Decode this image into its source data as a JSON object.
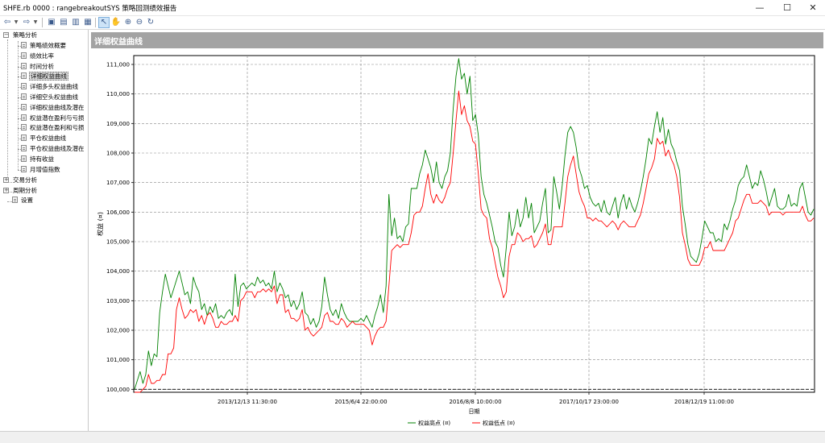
{
  "window": {
    "title": "SHFE.rb 0000 : rangebreakoutSYS 策略回测绩效报告",
    "min_glyph": "—",
    "max_glyph": "☐",
    "close_glyph": "✕"
  },
  "toolbar": {
    "icons": [
      "back-arrow-icon",
      "forward-arrow-icon",
      "save-icon",
      "print-preview-icon",
      "print-icon",
      "report-icon",
      "select-arrow-icon",
      "pan-hand-icon",
      "zoom-in-icon",
      "zoom-out-icon",
      "refresh-icon"
    ]
  },
  "tree": {
    "root_strategy": "策略分析",
    "items": [
      "策略绩效概要",
      "绩效比率",
      "时间分析",
      "详细权益曲线",
      "详细多头权益曲线",
      "详细空头权益曲线",
      "详细权益曲线及潜在",
      "权益潜在盈利与亏损",
      "权益潜在盈利和亏损",
      "平仓权益曲线",
      "平仓权益曲线及潜在",
      "持有收益",
      "月增值指数"
    ],
    "selected_index": 3,
    "root_trade": "交易分析",
    "root_period": "周期分析",
    "root_settings": "设置"
  },
  "content": {
    "header_title": "详细权益曲线"
  },
  "chart_data": {
    "type": "line",
    "ylabel": "权益 (¤)",
    "xlabel": "日期",
    "y_ticks": [
      "100,000",
      "101,000",
      "102,000",
      "103,000",
      "104,000",
      "105,000",
      "106,000",
      "107,000",
      "108,000",
      "109,000",
      "110,000",
      "111,000"
    ],
    "ylim": [
      99900,
      111300
    ],
    "x_ticks": [
      "2013/12/13 11:30:00",
      "2015/6/4 22:00:00",
      "2016/8/8 10:00:00",
      "2017/10/17 23:00:00",
      "2018/12/19 11:00:00"
    ],
    "baseline": 100000,
    "grid": true,
    "legend_position": "bottom",
    "series": [
      {
        "name": "权益高点 (¤)",
        "color": "#008000",
        "values": [
          100000,
          100300,
          100600,
          100200,
          100500,
          101300,
          100800,
          101200,
          101100,
          102600,
          103300,
          103900,
          103500,
          103100,
          103400,
          103700,
          104000,
          103600,
          103200,
          103300,
          102900,
          103800,
          103500,
          103300,
          102700,
          102900,
          102500,
          102800,
          102600,
          102900,
          102400,
          102500,
          102400,
          102600,
          102700,
          102500,
          103900,
          102800,
          103500,
          103600,
          103400,
          103500,
          103600,
          103500,
          103800,
          103600,
          103700,
          103500,
          103600,
          103400,
          104000,
          103300,
          103600,
          103400,
          103100,
          103200,
          102800,
          103000,
          102700,
          102900,
          103300,
          102600,
          102500,
          102200,
          102400,
          102100,
          102300,
          102800,
          103800,
          103200,
          102700,
          102500,
          102700,
          102400,
          102900,
          102600,
          102400,
          102300,
          102300,
          102300,
          102300,
          102400,
          102300,
          102500,
          102300,
          102100,
          102500,
          102800,
          103200,
          102600,
          103500,
          106600,
          105200,
          105800,
          105100,
          105200,
          105000,
          105500,
          105600,
          106800,
          106800,
          106800,
          107300,
          107600,
          108100,
          107800,
          107500,
          107000,
          107700,
          107000,
          106800,
          107200,
          107400,
          108000,
          109500,
          110600,
          111200,
          110500,
          110700,
          110000,
          110600,
          109100,
          109300,
          108600,
          107200,
          106600,
          106300,
          105900,
          105500,
          105000,
          104800,
          104200,
          103800,
          104800,
          106000,
          105200,
          105500,
          106100,
          105500,
          105800,
          106500,
          105800,
          106300,
          105300,
          105500,
          105700,
          106300,
          106800,
          105300,
          105400,
          107200,
          106700,
          106100,
          106900,
          107900,
          108700,
          108900,
          108700,
          108200,
          107500,
          107200,
          106800,
          106900,
          106500,
          106300,
          106200,
          106300,
          106000,
          106400,
          106000,
          105900,
          106200,
          106500,
          105800,
          106300,
          106600,
          106100,
          106500,
          106200,
          106000,
          106300,
          106700,
          107200,
          107800,
          108500,
          108300,
          108900,
          109400,
          108700,
          109200,
          108300,
          108800,
          108300,
          108100,
          107700,
          107400,
          106200,
          105600,
          104900,
          104500,
          104400,
          104300,
          104600,
          105100,
          105700,
          105500,
          105300,
          105300,
          105000,
          105100,
          105000,
          105600,
          105400,
          105700,
          106100,
          106400,
          106900,
          107100,
          107200,
          107600,
          107200,
          106800,
          107000,
          106900,
          107400,
          107100,
          106700,
          106200,
          106500,
          106800,
          106200,
          106100,
          106100,
          106200,
          106600,
          106200,
          106300,
          106200,
          106800,
          107000,
          106500,
          106000,
          105900,
          106100
        ]
      },
      {
        "name": "权益低点 (¤)",
        "color": "#ff0000",
        "values": [
          99900,
          99900,
          99900,
          100000,
          100100,
          100500,
          100200,
          100200,
          100300,
          100300,
          100500,
          100500,
          101200,
          101200,
          101400,
          102700,
          103100,
          102700,
          102400,
          102500,
          102700,
          102600,
          102700,
          102300,
          102500,
          102200,
          102500,
          102600,
          102400,
          102100,
          102100,
          102300,
          102200,
          102200,
          102300,
          102300,
          102500,
          102300,
          103000,
          103100,
          103300,
          103300,
          103300,
          103100,
          103300,
          103300,
          103400,
          103300,
          103400,
          103300,
          103500,
          102900,
          103200,
          103200,
          102600,
          102700,
          102400,
          102400,
          102300,
          102400,
          102700,
          102000,
          102100,
          101900,
          101800,
          101900,
          102000,
          102100,
          102500,
          102600,
          102300,
          102300,
          102200,
          102200,
          102400,
          102300,
          102100,
          102200,
          102300,
          102200,
          102200,
          102200,
          102200,
          102100,
          102000,
          101500,
          101800,
          102000,
          102100,
          102100,
          102300,
          103500,
          104700,
          104800,
          104900,
          104800,
          104900,
          104900,
          104900,
          105300,
          105900,
          106000,
          106000,
          106200,
          106800,
          107300,
          106600,
          106300,
          106600,
          106400,
          106300,
          106500,
          106800,
          107000,
          108000,
          109100,
          110100,
          109300,
          109600,
          109100,
          108900,
          108400,
          108300,
          107300,
          106100,
          105900,
          105800,
          105100,
          104800,
          104300,
          103800,
          103500,
          103100,
          103300,
          104500,
          104900,
          104900,
          105300,
          105200,
          105000,
          105100,
          105100,
          105200,
          104800,
          104900,
          105100,
          105300,
          105600,
          104900,
          104900,
          105500,
          105500,
          105500,
          105500,
          106300,
          107200,
          107600,
          107900,
          107300,
          106700,
          106400,
          106200,
          105800,
          105800,
          105700,
          105800,
          105700,
          105700,
          105600,
          105500,
          105600,
          105700,
          105600,
          105400,
          105600,
          105700,
          105600,
          105500,
          105500,
          105500,
          105700,
          105900,
          106300,
          106800,
          107300,
          107500,
          107800,
          108500,
          108300,
          108400,
          107900,
          108100,
          107800,
          107600,
          107200,
          106500,
          105300,
          104900,
          104400,
          104200,
          104200,
          104200,
          104200,
          104400,
          104800,
          104800,
          105000,
          104700,
          104700,
          104700,
          104700,
          104700,
          104900,
          105100,
          105300,
          105700,
          105800,
          106100,
          106400,
          106600,
          106600,
          106300,
          106300,
          106300,
          106400,
          106300,
          106200,
          105900,
          106000,
          106000,
          106000,
          106000,
          105900,
          106000,
          106000,
          106000,
          106000,
          106000,
          106000,
          106200,
          105900,
          105700,
          105700,
          105800
        ]
      }
    ]
  }
}
